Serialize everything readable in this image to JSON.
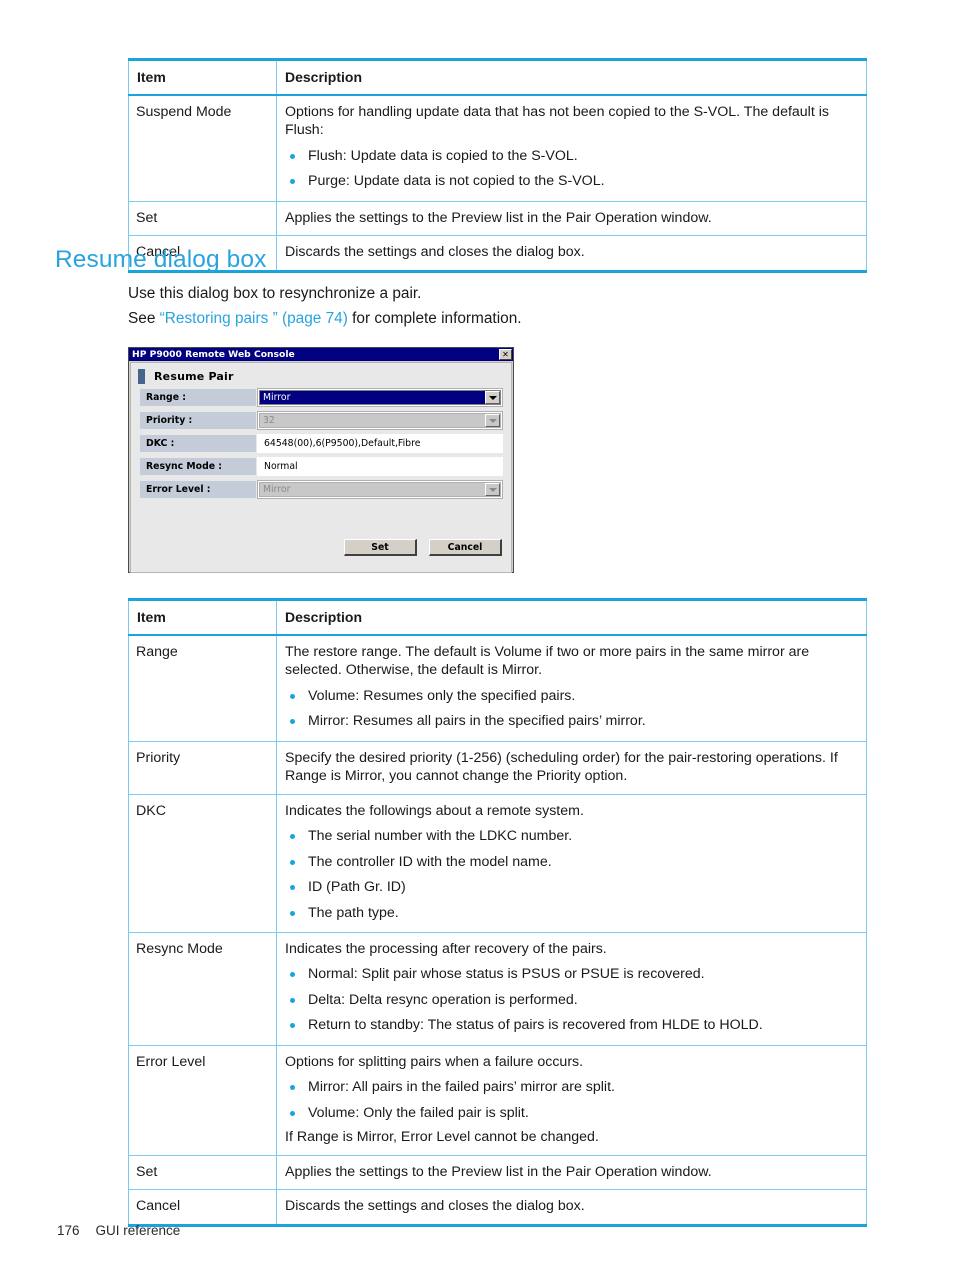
{
  "top_table": {
    "headers": [
      "Item",
      "Description"
    ],
    "rows": [
      {
        "item": "Suspend Mode",
        "desc_lead": "Options for handling update data that has not been copied to the S-VOL. The default is Flush:",
        "bullets": [
          "Flush: Update data is copied to the S-VOL.",
          "Purge: Update data is not copied to the S-VOL."
        ],
        "desc_tail": ""
      },
      {
        "item": "Set",
        "desc_lead": "Applies the settings to the Preview list in the Pair Operation window.",
        "bullets": [],
        "desc_tail": ""
      },
      {
        "item": "Cancel",
        "desc_lead": "Discards the settings and closes the dialog box.",
        "bullets": [],
        "desc_tail": ""
      }
    ]
  },
  "section": {
    "heading": "Resume dialog box",
    "intro_line1": "Use this dialog box to resynchronize a pair.",
    "intro_line2_pre": "See ",
    "intro_line2_link": "“Restoring pairs ” (page 74)",
    "intro_line2_post": " for complete information."
  },
  "dialog": {
    "window_title": "HP P9000 Remote Web Console",
    "close_glyph": "✕",
    "panel_title": "Resume Pair",
    "fields": [
      {
        "label": "Range :",
        "value": "Mirror",
        "control": "combo",
        "state": "selected"
      },
      {
        "label": "Priority :",
        "value": "32",
        "control": "combo",
        "state": "disabled"
      },
      {
        "label": "DKC :",
        "value": "64548(00),6(P9500),Default,Fibre",
        "control": "readonly",
        "state": "normal"
      },
      {
        "label": "Resync Mode :",
        "value": "Normal",
        "control": "readonly",
        "state": "normal"
      },
      {
        "label": "Error Level :",
        "value": "Mirror",
        "control": "combo",
        "state": "disabled"
      }
    ],
    "buttons": {
      "set": "Set",
      "cancel": "Cancel"
    }
  },
  "bottom_table": {
    "headers": [
      "Item",
      "Description"
    ],
    "rows": [
      {
        "item": "Range",
        "desc_lead": "The restore range. The default is Volume if two or more pairs in the same mirror are selected. Otherwise, the default is Mirror.",
        "bullets": [
          "Volume: Resumes only the specified pairs.",
          "Mirror: Resumes all pairs in the specified pairs’ mirror."
        ],
        "desc_tail": ""
      },
      {
        "item": "Priority",
        "desc_lead": "Specify the desired priority (1-256) (scheduling order) for the pair-restoring operations. If Range is Mirror, you cannot change the Priority option.",
        "bullets": [],
        "desc_tail": ""
      },
      {
        "item": "DKC",
        "desc_lead": "Indicates the followings about a remote system.",
        "bullets": [
          "The serial number with the LDKC number.",
          "The controller ID with the model name.",
          "ID (Path Gr. ID)",
          "The path type."
        ],
        "desc_tail": ""
      },
      {
        "item": "Resync Mode",
        "desc_lead": "Indicates the processing after recovery of the pairs.",
        "bullets": [
          "Normal: Split pair whose status is PSUS or PSUE is recovered.",
          "Delta: Delta resync operation is performed.",
          "Return to standby: The status of pairs is recovered from HLDE to HOLD."
        ],
        "desc_tail": ""
      },
      {
        "item": "Error Level",
        "desc_lead": "Options for splitting pairs when a failure occurs.",
        "bullets": [
          "Mirror: All pairs in the failed pairs’ mirror are split.",
          "Volume: Only the failed pair is split."
        ],
        "desc_tail": "If Range is Mirror, Error Level cannot be changed."
      },
      {
        "item": "Set",
        "desc_lead": "Applies the settings to the Preview list in the Pair Operation window.",
        "bullets": [],
        "desc_tail": ""
      },
      {
        "item": "Cancel",
        "desc_lead": "Discards the settings and closes the dialog box.",
        "bullets": [],
        "desc_tail": ""
      }
    ]
  },
  "footer": {
    "page_number": "176",
    "chapter": "GUI reference"
  },
  "colors": {
    "accent": "#1aa3dd",
    "link": "#29a3df",
    "table_border": "#7ccbed",
    "dialog_titlebar": "#000080"
  }
}
